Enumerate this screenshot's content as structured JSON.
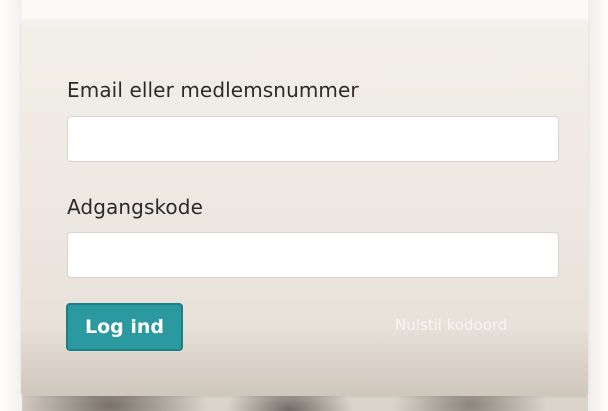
{
  "login_form": {
    "email_label": "Email eller medlemsnummer",
    "email_value": "",
    "password_label": "Adgangskode",
    "password_value": "",
    "submit_label": "Log ind",
    "reset_link_label": "Nulstil kodoord"
  },
  "colors": {
    "accent": "#2a9aa0",
    "card_background": "#ece7e0",
    "label_text": "#2b2b2b"
  }
}
